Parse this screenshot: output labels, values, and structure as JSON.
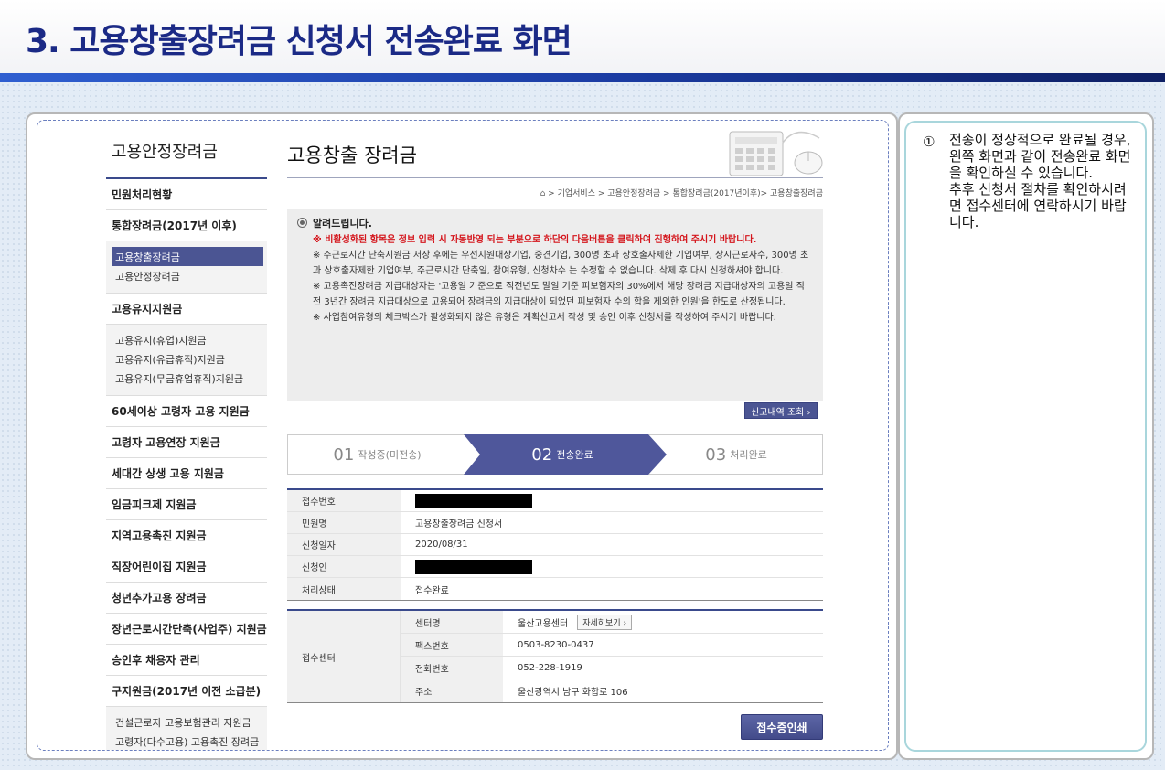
{
  "slide": {
    "title": "3. 고용창출장려금 신청서 전송완료 화면"
  },
  "nav": {
    "title": "고용안정장려금",
    "items": [
      {
        "label": "민원처리현황"
      },
      {
        "label": "통합장려금(2017년 이후)"
      },
      {
        "sub": [
          "고용창출장려금",
          "고용안정장려금"
        ],
        "active": 0
      },
      {
        "label": "고용유지지원금"
      },
      {
        "sub": [
          "고용유지(휴업)지원금",
          "고용유지(유급휴직)지원금",
          "고용유지(무급휴업휴직)지원금"
        ]
      },
      {
        "label": "60세이상 고령자 고용 지원금"
      },
      {
        "label": "고령자 고용연장 지원금"
      },
      {
        "label": "세대간 상생 고용 지원금"
      },
      {
        "label": "임금피크제 지원금"
      },
      {
        "label": "지역고용촉진 지원금"
      },
      {
        "label": "직장어린이집 지원금"
      },
      {
        "label": "청년추가고용 장려금"
      },
      {
        "label": "장년근로시간단축(사업주) 지원금"
      },
      {
        "label": "승인후 채용자 관리"
      },
      {
        "label": "구지원금(2017년 이전 소급분)"
      },
      {
        "sub": [
          "건설근로자 고용보험관리 지원금",
          "고령자(다수고용) 고용촉진 장려금"
        ]
      }
    ]
  },
  "main": {
    "title": "고용창출 장려금",
    "breadcrumb": "> 기업서비스 > 고용안정장려금 > 통합장려금(2017년이후)> 고용창출장려금",
    "notice": {
      "heading": "알려드립니다.",
      "red": "※ 비활성화된 항목은 정보 입력 시 자동반영 되는 부분으로 하단의 다음버튼을 클릭하여 진행하여 주시기 바랍니다.",
      "p1": "※ 주근로시간 단축지원금 저장 후에는 우선지원대상기업, 중견기업, 300명 초과 상호출자제한 기업여부, 상시근로자수, 300명 초과 상호출자제한 기업여부, 주근로시간 단축일, 참여유형, 신청차수 는 수정할 수 없습니다. 삭제 후 다시 신청하셔야 합니다.",
      "p2": "※ 고용촉진장려금 지급대상자는 '고용일 기준으로 직전년도 말일 기준 피보험자의 30%에서 해당 장려금 지급대상자의 고용일 직전 3년간 장려금 지급대상으로 고용되어 장려금의 지급대상이 되었던 피보험자 수의 합을 제외한 인원'을 한도로 산정됩니다.",
      "p3": "※ 사업참여유형의 체크박스가 활성화되지 않은 유형은 계획신고서 작성 및 승인 이후 신청서를 작성하여 주시기 바랍니다."
    },
    "history_button": "신고내역 조회 ›",
    "steps": [
      {
        "num": "01",
        "label": "작성중(미전송)"
      },
      {
        "num": "02",
        "label": "전송완료"
      },
      {
        "num": "03",
        "label": "처리완료"
      }
    ],
    "info": {
      "receipt_no": {
        "label": "접수번호",
        "value": ""
      },
      "petition": {
        "label": "민원명",
        "value": "고용창출장려금 신청서"
      },
      "apply_date": {
        "label": "신청일자",
        "value": "2020/08/31"
      },
      "applicant": {
        "label": "신청인",
        "value": ""
      },
      "status": {
        "label": "처리상태",
        "value": "접수완료"
      }
    },
    "center": {
      "label": "접수센터",
      "name_label": "센터명",
      "name": "울산고용센터",
      "detail_button": "자세히보기 ›",
      "fax_label": "팩스번호",
      "fax": "0503-8230-0437",
      "phone_label": "전화번호",
      "phone": "052-228-1919",
      "addr_label": "주소",
      "addr": "울산광역시 남구 화합로 106"
    },
    "print_button": "접수증인쇄"
  },
  "description": {
    "number": "①",
    "text": "전송이 정상적으로 완료될 경우, 왼쪽 화면과 같이 전송완료 화면을 확인하실 수 있습니다.\n추후 신청서 절차를 확인하시려면 접수센터에 연락하시기 바랍니다."
  },
  "colors": {
    "title": "#1b2a86",
    "accent": "#4b5593",
    "notice_red": "#d4141b"
  }
}
